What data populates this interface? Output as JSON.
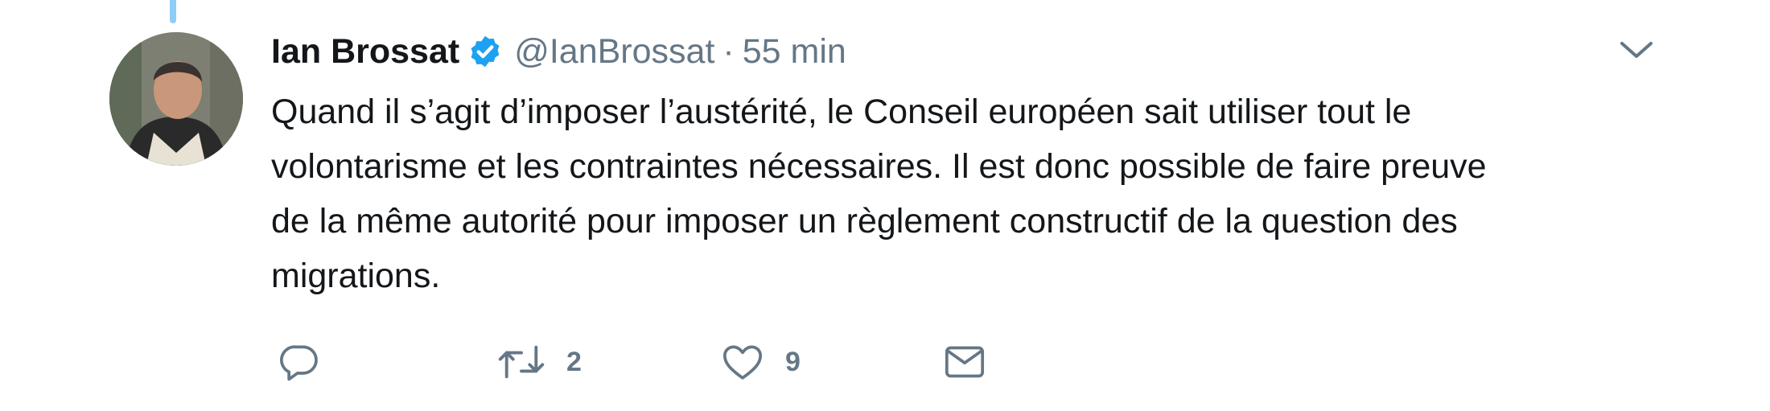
{
  "tweet": {
    "author_name": "Ian Brossat",
    "handle": "@IanBrossat",
    "separator": "·",
    "time": "55 min",
    "verified": true,
    "text_lines": [
      "Quand il s’agit d’imposer l’austérité, le Conseil européen sait utiliser tout le",
      "volontarisme et les contraintes nécessaires. Il est donc possible de faire preuve",
      "de la même autorité pour imposer un règlement constructif de la question des",
      "migrations."
    ]
  },
  "actions": {
    "reply_icon": "reply-icon",
    "retweet_icon": "retweet-icon",
    "retweet_count": "2",
    "like_icon": "heart-icon",
    "like_count": "9",
    "dm_icon": "envelope-icon"
  },
  "colors": {
    "text": "#14171a",
    "secondary": "#657786",
    "verified": "#1da1f2",
    "thread_line": "#8ecdf8"
  }
}
